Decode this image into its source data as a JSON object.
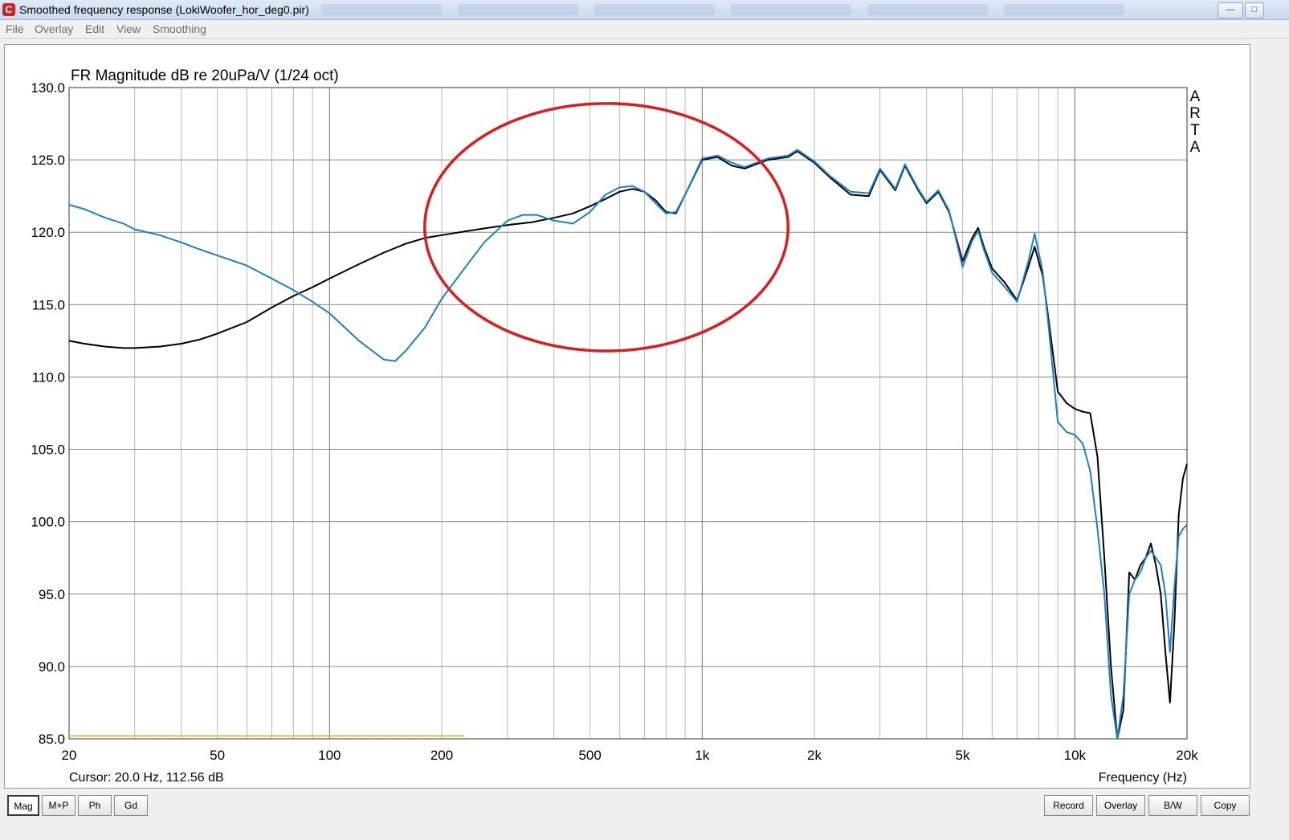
{
  "window": {
    "title": "Smoothed frequency response (LokiWoofer_hor_deg0.pir)",
    "icon": "arta-app-icon",
    "minimize_glyph": "—",
    "restore_glyph": "□"
  },
  "menu": {
    "items": [
      "File",
      "Overlay",
      "Edit",
      "View",
      "Smoothing"
    ]
  },
  "chart_data": {
    "type": "line",
    "title": "FR Magnitude dB re 20uPa/V (1/24 oct)",
    "xlabel": "Frequency (Hz)",
    "ylabel": "",
    "xscale": "log",
    "xlim": [
      20,
      20000
    ],
    "ylim": [
      85,
      130
    ],
    "yticks": [
      130,
      125,
      120,
      115,
      110,
      105,
      100,
      95,
      90,
      85
    ],
    "ytick_labels": [
      "130.0",
      "125.0",
      "120.0",
      "115.0",
      "110.0",
      "105.0",
      "100.0",
      "95.0",
      "90.0",
      "85.0"
    ],
    "xticks": [
      20,
      50,
      100,
      200,
      500,
      1000,
      2000,
      5000,
      10000,
      20000
    ],
    "xtick_labels": [
      "20",
      "50",
      "100",
      "200",
      "500",
      "1k",
      "2k",
      "5k",
      "10k",
      "20k"
    ],
    "grid": true,
    "side_label": "ARTA",
    "cursor_text": "Cursor: 20.0 Hz, 112.56 dB",
    "colors": {
      "black_series": "#000000",
      "blue_series": "#1f7fc4",
      "ellipse": "#d81e1e",
      "baseline": "#c8c84a"
    },
    "annotation": {
      "type": "ellipse",
      "x_range": [
        180,
        1700
      ],
      "y_range": [
        111.8,
        128.9
      ],
      "color": "#d81e1e"
    },
    "baseline": {
      "x": [
        20,
        230
      ],
      "y": 85.2,
      "color": "#c8c84a"
    },
    "series": [
      {
        "x": [
          20,
          22,
          25,
          28,
          30,
          35,
          40,
          45,
          50,
          60,
          70,
          80,
          90,
          100,
          120,
          140,
          160,
          180,
          200,
          250,
          300,
          350,
          400,
          450,
          500,
          550,
          600,
          650,
          700,
          750,
          800,
          850,
          900,
          1000,
          1100,
          1200,
          1300,
          1500,
          1700,
          1800,
          2000,
          2200,
          2500,
          2800,
          3000,
          3300,
          3500,
          3800,
          4000,
          4300,
          4600,
          5000,
          5300,
          5500,
          5700,
          6000,
          6500,
          7000,
          7500,
          7800,
          8200,
          8500,
          9000,
          9500,
          10000,
          10500,
          11000,
          11500,
          12000,
          12500,
          13000,
          13500,
          14000,
          14500,
          15000,
          15500,
          16000,
          16500,
          17000,
          17500,
          18000,
          18500,
          19000,
          19500,
          20000
        ],
        "y": [
          112.5,
          112.3,
          112.1,
          112.0,
          112.0,
          112.1,
          112.3,
          112.6,
          113.0,
          113.8,
          114.8,
          115.6,
          116.2,
          116.8,
          117.8,
          118.6,
          119.2,
          119.6,
          119.8,
          120.2,
          120.5,
          120.7,
          121.0,
          121.3,
          121.8,
          122.3,
          122.8,
          123.0,
          122.8,
          122.2,
          121.4,
          121.3,
          122.6,
          125.0,
          125.2,
          124.6,
          124.4,
          125.0,
          125.2,
          125.6,
          124.8,
          123.8,
          122.6,
          122.5,
          124.3,
          122.9,
          124.6,
          122.9,
          122.0,
          122.8,
          121.4,
          118.0,
          119.6,
          120.3,
          119.0,
          117.5,
          116.5,
          115.3,
          117.6,
          119.0,
          117.0,
          114.0,
          109.0,
          108.2,
          107.8,
          107.6,
          107.5,
          104.5,
          97.5,
          90.0,
          85.0,
          87.0,
          96.5,
          96.0,
          97.0,
          97.5,
          98.5,
          97.0,
          95.0,
          91.0,
          87.5,
          93.0,
          100.5,
          103.0,
          104.0
        ]
      },
      {
        "x": [
          20,
          22,
          25,
          28,
          30,
          35,
          40,
          45,
          50,
          60,
          70,
          80,
          90,
          100,
          120,
          140,
          150,
          160,
          180,
          200,
          230,
          260,
          300,
          330,
          360,
          400,
          450,
          500,
          550,
          600,
          650,
          700,
          750,
          800,
          850,
          900,
          1000,
          1100,
          1200,
          1300,
          1500,
          1700,
          1800,
          2000,
          2200,
          2500,
          2800,
          3000,
          3300,
          3500,
          3800,
          4000,
          4300,
          4600,
          5000,
          5300,
          5500,
          5700,
          6000,
          6500,
          7000,
          7500,
          7800,
          8200,
          8500,
          9000,
          9500,
          10000,
          10500,
          11000,
          11500,
          12000,
          12500,
          13000,
          13500,
          14000,
          14500,
          15000,
          15500,
          16000,
          16500,
          17000,
          17500,
          18000,
          18500,
          19000,
          19500,
          20000
        ],
        "y": [
          121.9,
          121.6,
          121.0,
          120.6,
          120.2,
          119.8,
          119.3,
          118.8,
          118.4,
          117.7,
          116.8,
          116.0,
          115.2,
          114.4,
          112.5,
          111.2,
          111.1,
          111.8,
          113.4,
          115.4,
          117.5,
          119.3,
          120.8,
          121.2,
          121.2,
          120.8,
          120.6,
          121.4,
          122.6,
          123.1,
          123.2,
          122.8,
          122.0,
          121.3,
          121.4,
          122.6,
          125.1,
          125.3,
          124.8,
          124.5,
          125.1,
          125.3,
          125.7,
          124.9,
          123.9,
          122.8,
          122.7,
          124.4,
          123.0,
          124.7,
          123.0,
          122.1,
          122.9,
          121.5,
          117.6,
          119.4,
          120.1,
          118.8,
          117.2,
          116.2,
          115.2,
          118.0,
          119.9,
          117.3,
          113.5,
          106.9,
          106.2,
          106.0,
          105.4,
          103.5,
          99.5,
          95.0,
          88.0,
          85.0,
          88.0,
          95.0,
          96.0,
          96.5,
          97.5,
          98.0,
          97.5,
          97.0,
          95.0,
          91.0,
          95.5,
          99.0,
          99.5,
          99.8
        ]
      }
    ]
  },
  "bottom": {
    "left_buttons": [
      "Mag",
      "M+P",
      "Ph",
      "Gd"
    ],
    "right_buttons": [
      "Record",
      "Overlay",
      "B/W",
      "Copy"
    ]
  }
}
